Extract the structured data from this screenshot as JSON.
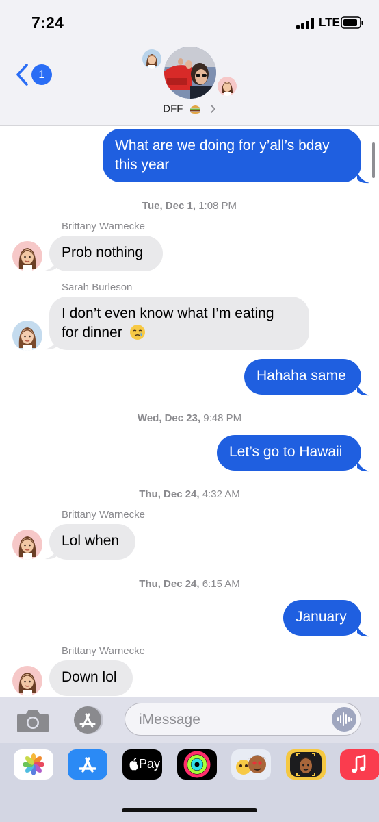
{
  "status": {
    "time": "7:24",
    "network": "LTE"
  },
  "header": {
    "back_badge": "1",
    "group_name": "DFF"
  },
  "messages": [
    {
      "type": "outgoing",
      "text_lines": [
        "What are we doing for y’all’s bday",
        "this year"
      ]
    },
    {
      "type": "timestamp",
      "day": "Tue, Dec 1,",
      "time": "1:08 PM"
    },
    {
      "type": "sender",
      "name": "Brittany Warnecke"
    },
    {
      "type": "incoming",
      "text": "Prob nothing"
    },
    {
      "type": "sender",
      "name": "Sarah Burleson"
    },
    {
      "type": "incoming",
      "text_lines": [
        "I don’t even know what I’m eating",
        "for dinner"
      ]
    },
    {
      "type": "outgoing",
      "text": "Hahaha same"
    },
    {
      "type": "timestamp",
      "day": "Wed, Dec 23,",
      "time": "9:48 PM"
    },
    {
      "type": "outgoing",
      "text": "Let’s go to Hawaii"
    },
    {
      "type": "timestamp",
      "day": "Thu, Dec 24,",
      "time": "4:32 AM"
    },
    {
      "type": "sender",
      "name": "Brittany Warnecke"
    },
    {
      "type": "incoming",
      "text": "Lol when"
    },
    {
      "type": "timestamp",
      "day": "Thu, Dec 24,",
      "time": "6:15 AM"
    },
    {
      "type": "outgoing",
      "text": "January"
    },
    {
      "type": "sender",
      "name": "Brittany Warnecke"
    },
    {
      "type": "incoming",
      "text": "Down lol"
    }
  ],
  "input": {
    "placeholder": "iMessage",
    "value": ""
  },
  "app_strip": {
    "apple_pay_label": "Pay",
    "icons": [
      "photos-app-icon",
      "app-store-app-icon",
      "apple-pay-app-icon",
      "activity-app-icon",
      "memoji-stickers-app-icon",
      "memoji-app-icon",
      "music-app-icon"
    ]
  },
  "colors": {
    "outgoing_bubble": "#1f5fe0",
    "incoming_bubble": "#e9e9eb",
    "header_bg": "#f2f2f6",
    "accent": "#2a6df5"
  }
}
